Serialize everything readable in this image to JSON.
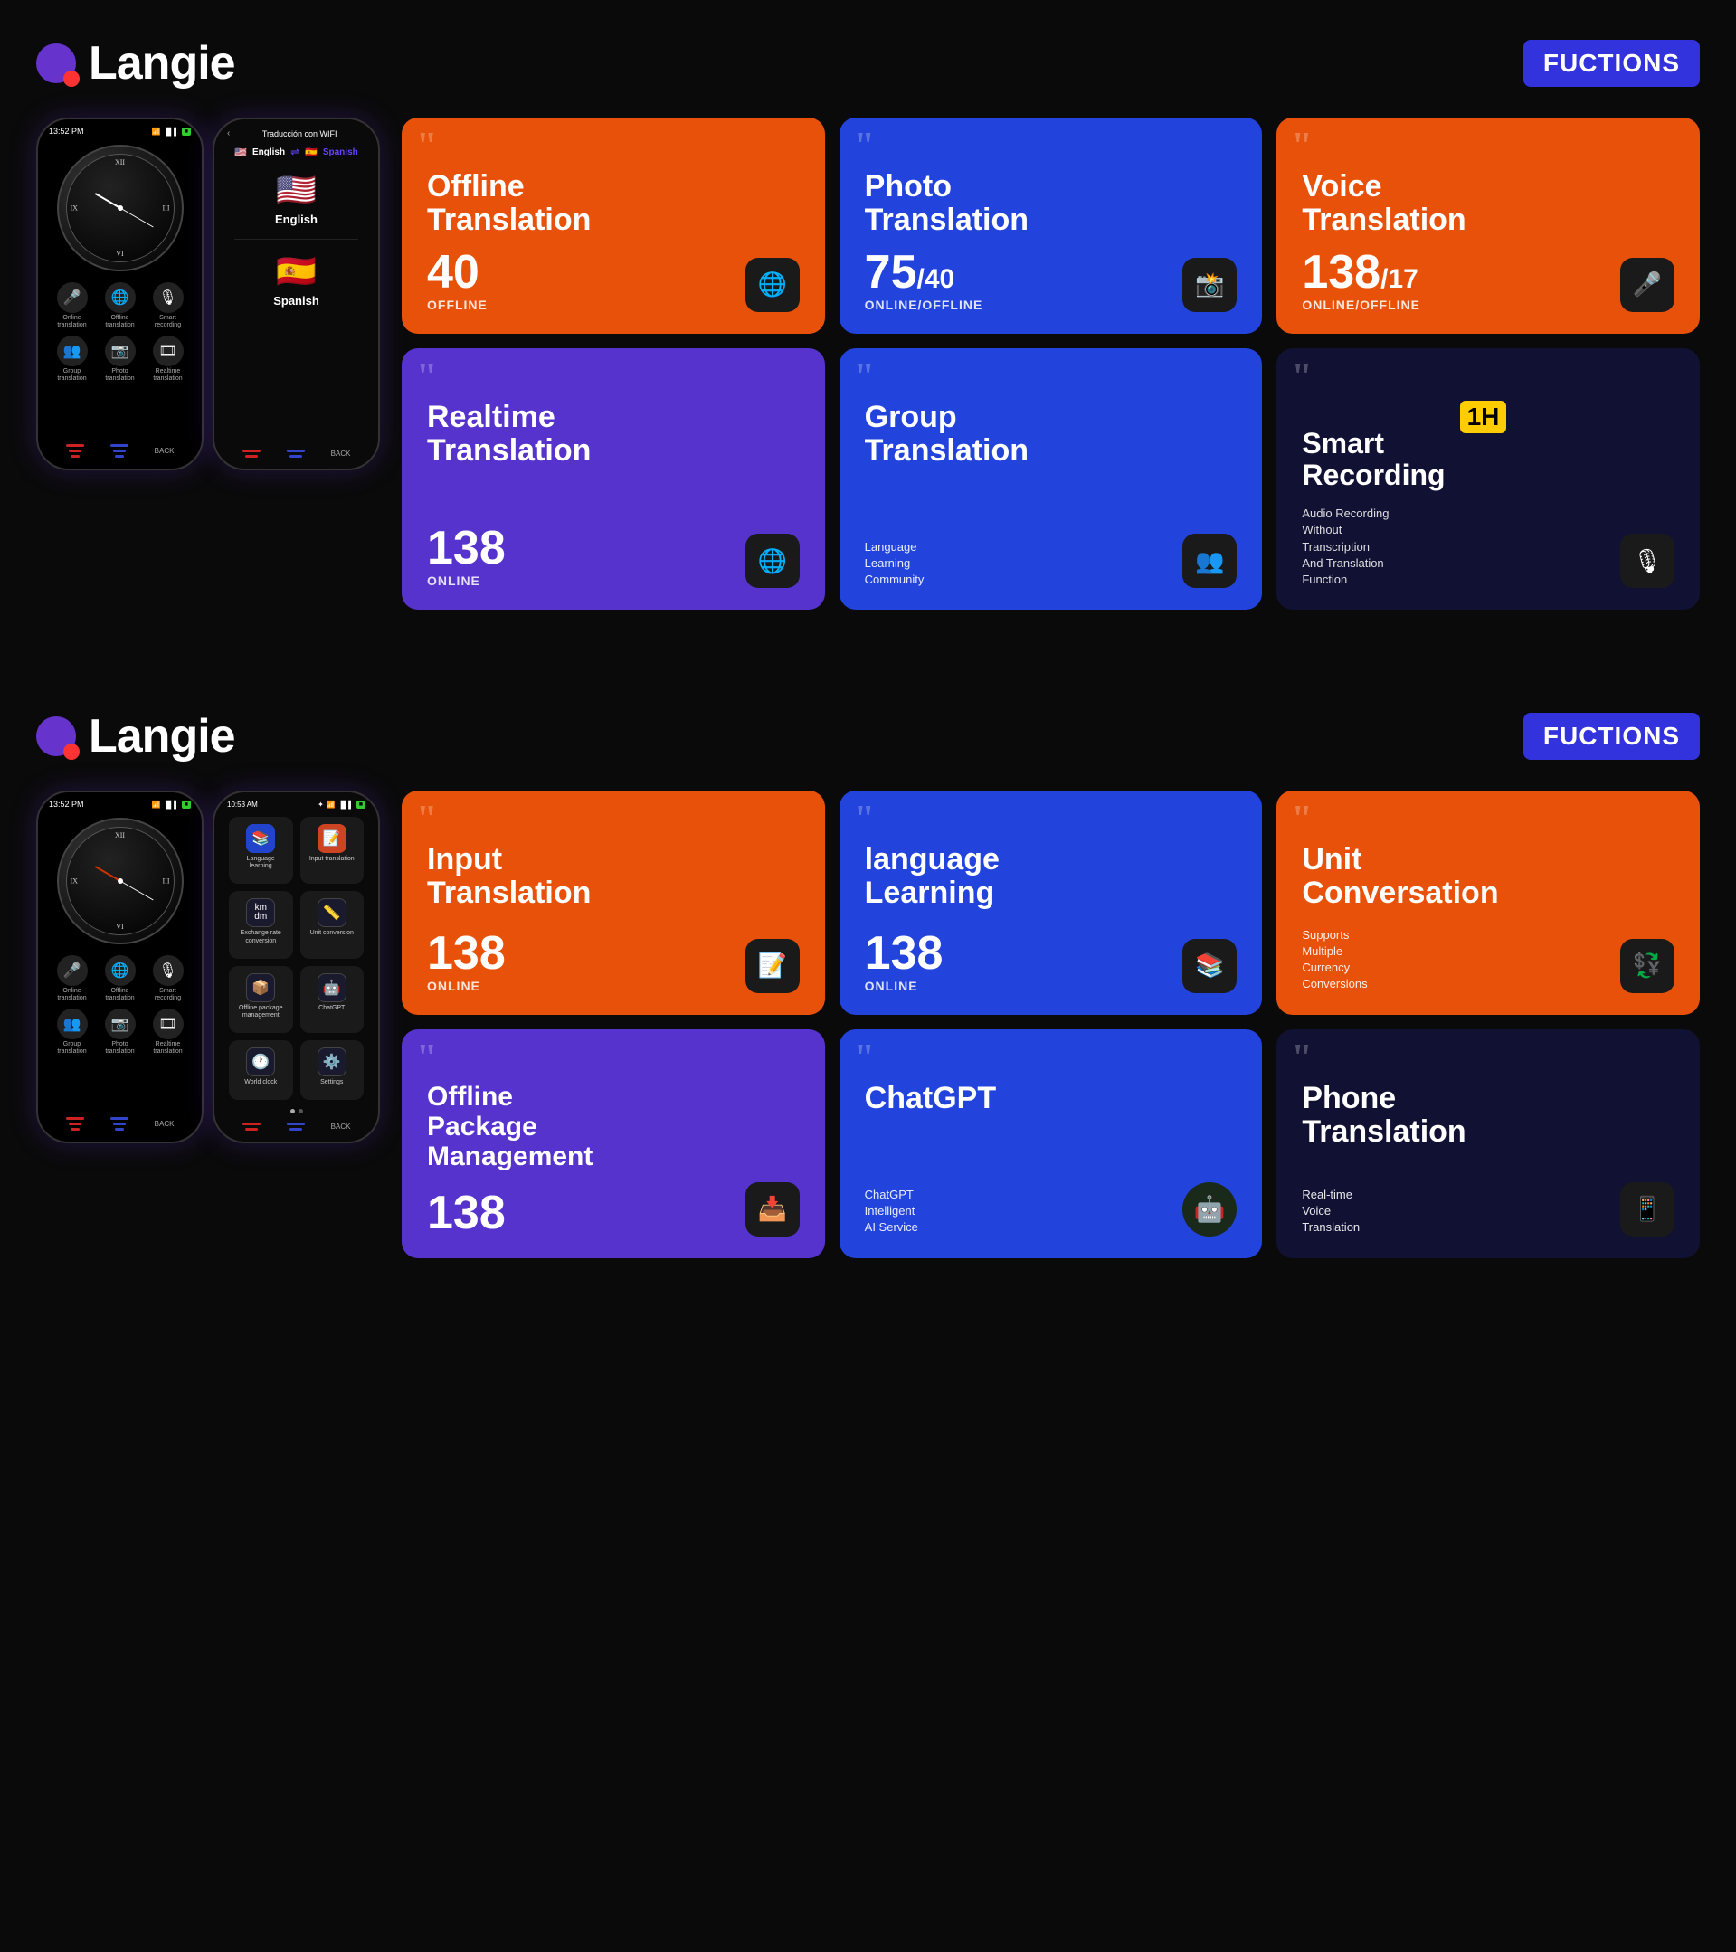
{
  "section1": {
    "logo": "Langie",
    "badge": "FUCTIONS",
    "phone1": {
      "time": "13:52 PM",
      "appIcons": [
        {
          "icon": "🎤",
          "label": "Online\ntranslation"
        },
        {
          "icon": "🌐",
          "label": "Offline\ntranslation"
        },
        {
          "icon": "🎙",
          "label": "Smart\nrecording"
        },
        {
          "icon": "👥",
          "label": "Group\ntranslation"
        },
        {
          "icon": "📷",
          "label": "Photo\ntranslation"
        },
        {
          "icon": "🎞",
          "label": "Realtime\ntranslation"
        }
      ]
    },
    "phone2": {
      "title": "Traducción con WIFI",
      "langLeft": "English",
      "langRight": "Spanish",
      "flagLeft": "🇺🇸",
      "flagRight": "🇪🇸"
    },
    "cards": [
      {
        "id": "offline-translation",
        "title": "Offline\nTranslation",
        "count": "40",
        "subtitle": "OFFLINE",
        "icon": "🌐",
        "color": "orange"
      },
      {
        "id": "photo-translation",
        "title": "Photo\nTranslation",
        "count": "75",
        "countSlash": "/40",
        "subtitle": "ONLINE/OFFLINE",
        "icon": "📸",
        "color": "blue"
      },
      {
        "id": "voice-translation",
        "title": "Voice\nTranslation",
        "count": "138",
        "countSlash": "/17",
        "subtitle": "ONLINE/OFFLINE",
        "icon": "🎤",
        "color": "orange"
      },
      {
        "id": "realtime-translation",
        "title": "Realtime\nTranslation",
        "count": "138",
        "subtitle": "ONLINE",
        "icon": "🌐",
        "color": "purple"
      },
      {
        "id": "group-translation",
        "title": "Group\nTranslation",
        "desc": "Language\nLearning\nCommunity",
        "icon": "👥",
        "color": "blue"
      },
      {
        "id": "smart-recording",
        "title": "Smart\nRecording",
        "badge": "1H",
        "desc": "Audio Recording\nWithout\nTranscription\nAnd Translation\nFunction",
        "icon": "🎙",
        "color": "dark"
      }
    ]
  },
  "section2": {
    "logo": "Langie",
    "badge": "FUCTIONS",
    "phone1": {
      "time": "13:52 PM"
    },
    "phone2": {
      "time": "10:53 AM",
      "menuItems": [
        {
          "icon": "📚",
          "label": "Language learning"
        },
        {
          "icon": "📝",
          "label": "Input translation"
        },
        {
          "icon": "💱",
          "label": "Exchange rate\nconversion"
        },
        {
          "icon": "📏",
          "label": "Unit conversion"
        },
        {
          "icon": "📦",
          "label": "Offline package\nmanagement"
        },
        {
          "icon": "🤖",
          "label": "ChatGPT"
        },
        {
          "icon": "🕐",
          "label": "World clock"
        },
        {
          "icon": "⚙️",
          "label": "Settings"
        }
      ]
    },
    "cards": [
      {
        "id": "input-translation",
        "title": "Input\nTranslation",
        "count": "138",
        "subtitle": "ONLINE",
        "icon": "📝",
        "color": "orange"
      },
      {
        "id": "language-learning",
        "title": "language\nLearning",
        "count": "138",
        "subtitle": "ONLINE",
        "icon": "📚",
        "color": "blue"
      },
      {
        "id": "unit-conversation",
        "title": "Unit\nConversation",
        "desc": "Supports\nMultiple\nCurrency\nConversions",
        "icon": "💱",
        "color": "orange"
      },
      {
        "id": "offline-package",
        "title": "Offline\nPackage\nManagement",
        "count": "138",
        "subtitle": "",
        "icon": "📥",
        "color": "purple"
      },
      {
        "id": "chatgpt",
        "title": "ChatGPT",
        "desc": "ChatGPT\nIntelligent\nAI Service",
        "icon": "🤖",
        "color": "blue"
      },
      {
        "id": "phone-translation",
        "title": "Phone\nTranslation",
        "desc": "Real-time\nVoice\nTranslation",
        "icon": "📱",
        "color": "dark"
      }
    ]
  }
}
